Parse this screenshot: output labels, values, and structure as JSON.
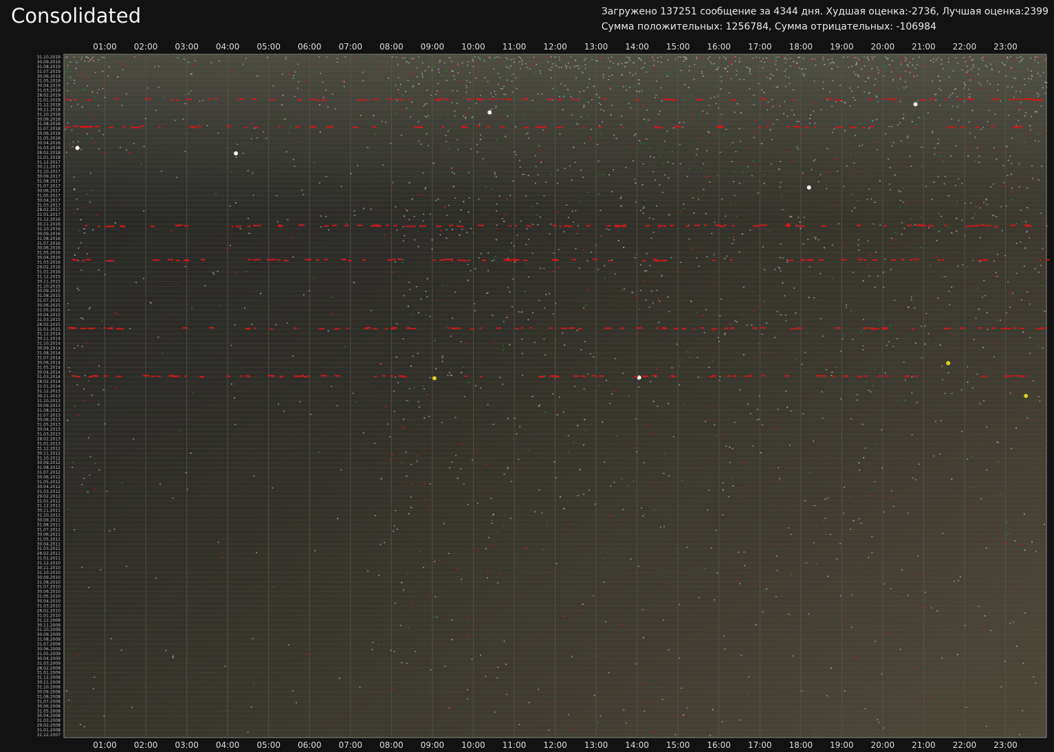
{
  "window": {
    "title": "Consolidated"
  },
  "stats": {
    "line1": "Загружено 137251 сообщение за 4344 дня. Худшая оценка:-2736, Лучшая оценка:2399",
    "line2": "Сумма положительных: 1256784, Сумма отрицательных: -106984"
  },
  "colors": {
    "background": "#121212",
    "plot_night": "#2a2a2a",
    "plot_day": "#4a4535",
    "gridline": "#5a5a50",
    "negative": "#d01818",
    "positive": "#1a8a1a",
    "neutral": "#9a9a9a",
    "highlight": "#ffffff",
    "yellow": "#e0d020"
  },
  "chart_data": {
    "type": "scatter",
    "x_axis": {
      "unit": "hour of day",
      "range": [
        0,
        24
      ],
      "ticks": [
        "01:00",
        "02:00",
        "03:00",
        "04:00",
        "05:00",
        "06:00",
        "07:00",
        "08:00",
        "09:00",
        "10:00",
        "11:00",
        "12:00",
        "13:00",
        "14:00",
        "15:00",
        "16:00",
        "17:00",
        "18:00",
        "19:00",
        "20:00",
        "21:00",
        "22:00",
        "23:00"
      ],
      "labels_top_and_bottom": true
    },
    "y_axis": {
      "unit": "date",
      "range": [
        "31.12.2007",
        "31.10.2019"
      ],
      "tick_labels_top_to_bottom": [
        "31.10.2019",
        "30.09.2019",
        "31.08.2019",
        "31.07.2019",
        "30.06.2019",
        "31.05.2019",
        "30.04.2019",
        "31.03.2019",
        "28.02.2019",
        "31.01.2019",
        "31.12.2018",
        "30.11.2018",
        "31.10.2018",
        "30.09.2018",
        "31.08.2018",
        "31.07.2018",
        "30.06.2018",
        "31.05.2018",
        "30.04.2018",
        "31.03.2018",
        "28.02.2018",
        "31.01.2018",
        "31.12.2017",
        "30.11.2017",
        "31.10.2017",
        "30.09.2017",
        "31.08.2017",
        "31.07.2017",
        "30.06.2017",
        "31.05.2017",
        "30.04.2017",
        "31.03.2017",
        "28.02.2017",
        "31.01.2017",
        "31.12.2016",
        "30.11.2016",
        "31.10.2016",
        "30.09.2016",
        "31.08.2016",
        "31.07.2016",
        "30.06.2016",
        "31.05.2016",
        "30.04.2016",
        "31.03.2016",
        "29.02.2016",
        "31.01.2016",
        "31.12.2015",
        "30.11.2015",
        "31.10.2015",
        "30.09.2015",
        "31.08.2015",
        "31.07.2015",
        "30.06.2015",
        "31.05.2015",
        "30.04.2015",
        "31.03.2015",
        "28.02.2015",
        "31.01.2015",
        "31.12.2014",
        "30.11.2014",
        "31.10.2014",
        "30.09.2014",
        "31.08.2014",
        "31.07.2014",
        "30.06.2014",
        "31.05.2014",
        "30.04.2014",
        "31.03.2014",
        "28.02.2014",
        "31.01.2014",
        "31.12.2013",
        "30.11.2013",
        "31.10.2013",
        "30.09.2013",
        "31.08.2013",
        "31.07.2013",
        "30.06.2013",
        "31.05.2013",
        "30.04.2013",
        "31.03.2013",
        "28.02.2013",
        "31.01.2013",
        "31.12.2012",
        "30.11.2012",
        "31.10.2012",
        "30.09.2012",
        "31.08.2012",
        "31.07.2012",
        "30.06.2012",
        "31.05.2012",
        "30.04.2012",
        "31.03.2012",
        "29.02.2012",
        "31.01.2012",
        "31.12.2011",
        "30.11.2011",
        "31.10.2011",
        "30.09.2011",
        "31.08.2011",
        "31.07.2011",
        "30.06.2011",
        "31.05.2011",
        "30.04.2011",
        "31.03.2011",
        "28.02.2011",
        "31.01.2011",
        "31.12.2010",
        "30.11.2010",
        "31.10.2010",
        "30.09.2010",
        "31.08.2010",
        "31.07.2010",
        "30.06.2010",
        "31.05.2010",
        "30.04.2010",
        "31.03.2010",
        "28.02.2010",
        "31.01.2010",
        "31.12.2009",
        "30.11.2009",
        "31.10.2009",
        "30.09.2009",
        "31.08.2009",
        "31.07.2009",
        "30.06.2009",
        "31.05.2009",
        "30.04.2009",
        "31.03.2009",
        "28.02.2009",
        "31.01.2009",
        "31.12.2008",
        "30.11.2008",
        "31.10.2008",
        "30.09.2008",
        "31.08.2008",
        "31.07.2008",
        "30.06.2008",
        "31.05.2008",
        "30.04.2008",
        "31.03.2008",
        "29.02.2008",
        "31.01.2008",
        "31.12.2007"
      ]
    },
    "grid": true,
    "series_colors": {
      "negative": "red",
      "positive": "green",
      "neutral": "grey",
      "extreme": "white / yellow"
    },
    "summary": {
      "messages": 137251,
      "days": 4344,
      "worst_score": -2736,
      "best_score": 2399,
      "sum_positive": 1256784,
      "sum_negative": -106984
    }
  }
}
